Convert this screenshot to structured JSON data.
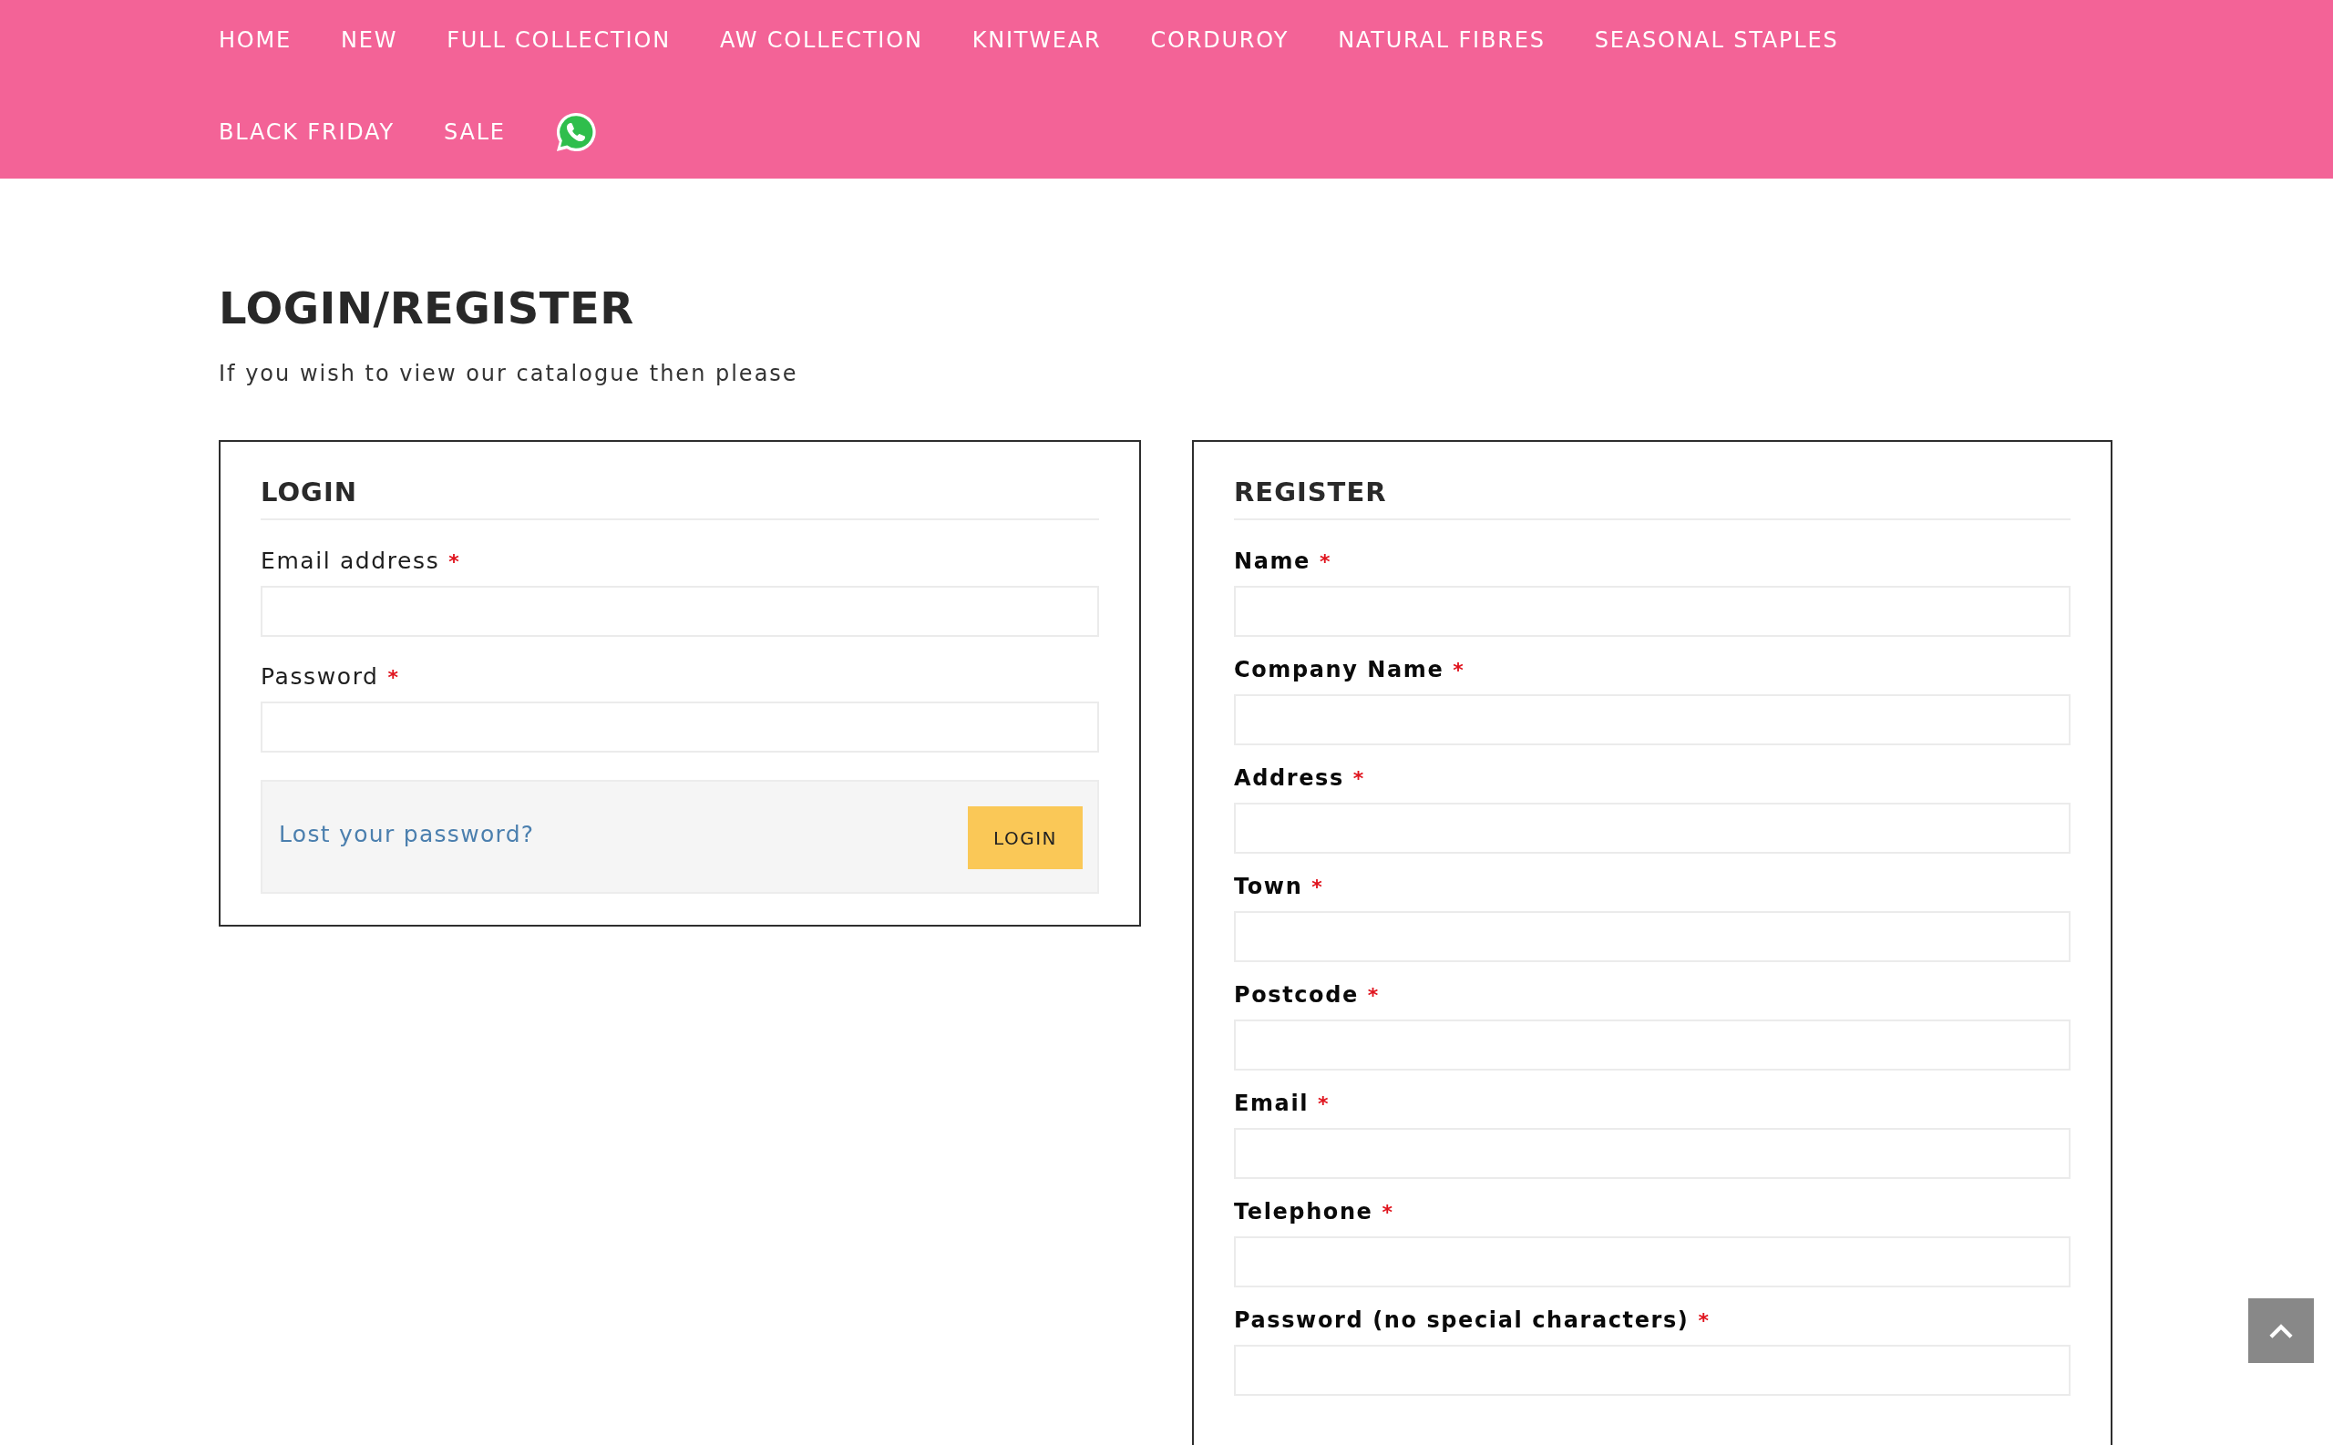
{
  "nav": {
    "items": [
      "HOME",
      "NEW",
      "FULL COLLECTION",
      "AW COLLECTION",
      "KNITWEAR",
      "CORDUROY",
      "NATURAL FIBRES",
      "SEASONAL STAPLES",
      "BLACK FRIDAY",
      "SALE"
    ]
  },
  "page": {
    "title": "LOGIN/REGISTER",
    "intro": "If you wish to view our catalogue then please"
  },
  "login": {
    "heading": "LOGIN",
    "fields": [
      {
        "label": "Email address",
        "mark": "*"
      },
      {
        "label": "Password",
        "mark": "*"
      }
    ],
    "actions": {
      "link": "Lost your password?",
      "button": "LOGIN"
    }
  },
  "register": {
    "heading": "REGISTER",
    "fields": [
      {
        "label": "Name",
        "mark": "*"
      },
      {
        "label": "Company Name",
        "mark": "*"
      },
      {
        "label": "Address",
        "mark": "*"
      },
      {
        "label": "Town",
        "mark": "*"
      },
      {
        "label": "Postcode",
        "mark": "*"
      },
      {
        "label": "Email",
        "mark": "*"
      },
      {
        "label": "Telephone",
        "mark": "*"
      },
      {
        "label": "Password (no special characters)",
        "mark": "*"
      }
    ]
  }
}
